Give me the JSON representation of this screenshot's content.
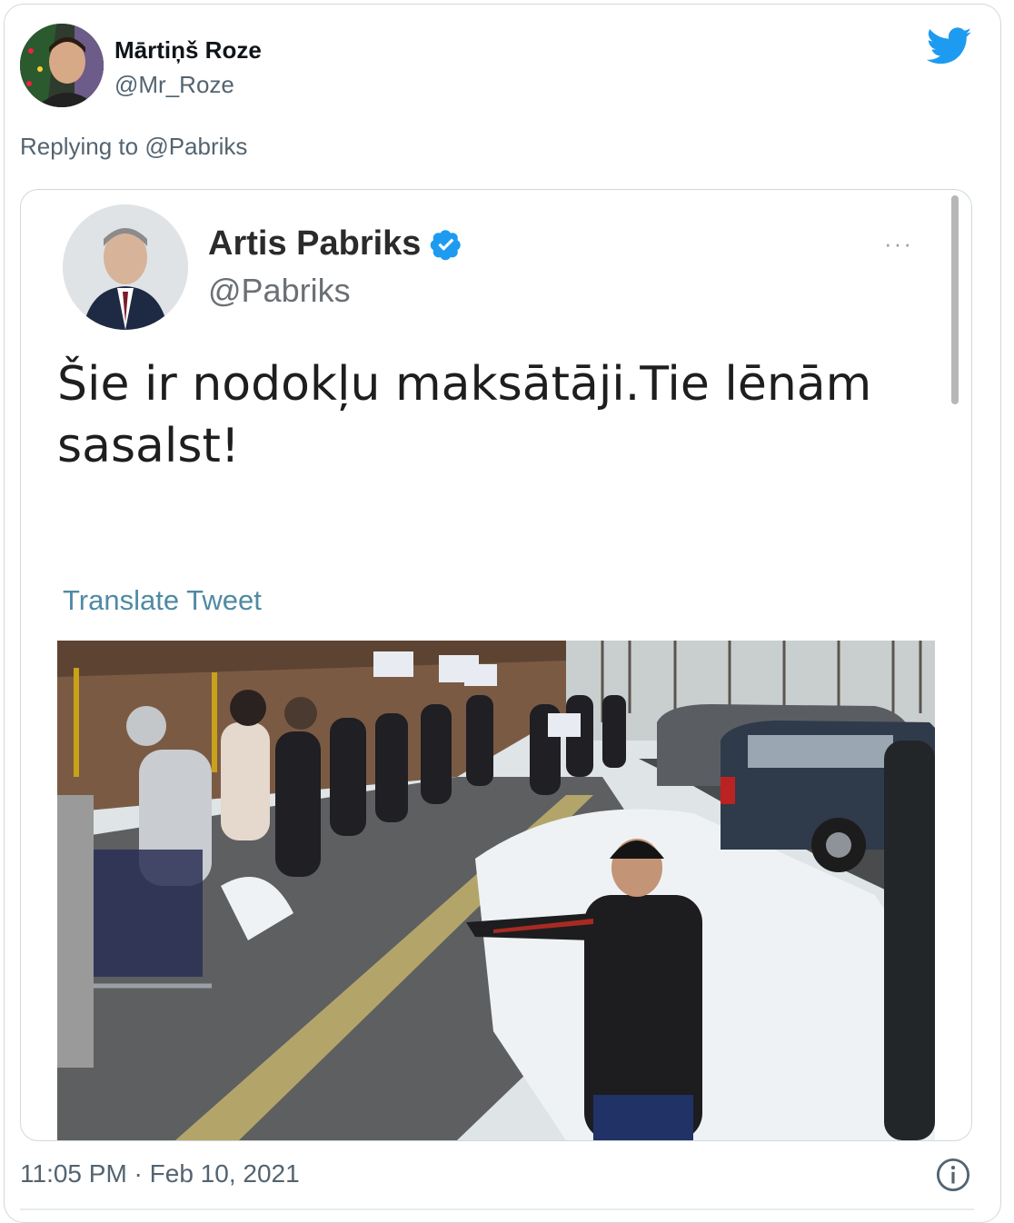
{
  "tweet": {
    "author_name": "Mārtiņš Roze",
    "author_handle": "@Mr_Roze",
    "replying_prefix": "Replying to",
    "replying_to": "@Pabriks",
    "timestamp": "11:05 PM · Feb 10, 2021"
  },
  "quoted": {
    "author_name": "Artis Pabriks",
    "author_handle": "@Pabriks",
    "more": "···",
    "text": "Šie ir nodokļu maksātāji.Tie lēnām sasalst!",
    "translate_label": "Translate Tweet"
  },
  "icons": {
    "brand": "twitter-bird-icon",
    "verified": "verified-badge-icon",
    "info": "info-icon"
  },
  "colors": {
    "brand_blue": "#1d9bf0",
    "muted_text": "#536471",
    "translate_link": "#4f8aa3"
  }
}
